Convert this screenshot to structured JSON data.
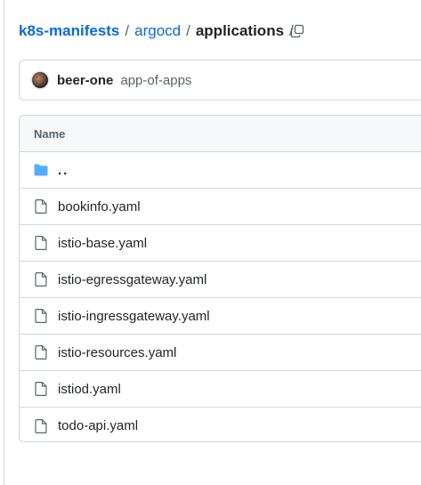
{
  "breadcrumb": {
    "repo": "k8s-manifests",
    "dir1": "argocd",
    "current": "applications",
    "separator": "/"
  },
  "commit": {
    "author": "beer-one",
    "message": "app-of-apps"
  },
  "table": {
    "header": "Name",
    "parent": "..",
    "files": [
      "bookinfo.yaml",
      "istio-base.yaml",
      "istio-egressgateway.yaml",
      "istio-ingressgateway.yaml",
      "istio-resources.yaml",
      "istiod.yaml",
      "todo-api.yaml"
    ]
  },
  "icons": {
    "copy": "copy-icon",
    "folder": "folder-icon",
    "file": "file-icon"
  },
  "colors": {
    "link": "#0969da",
    "folder": "#54aeff",
    "border": "#d0d7de",
    "muted": "#59636e"
  }
}
